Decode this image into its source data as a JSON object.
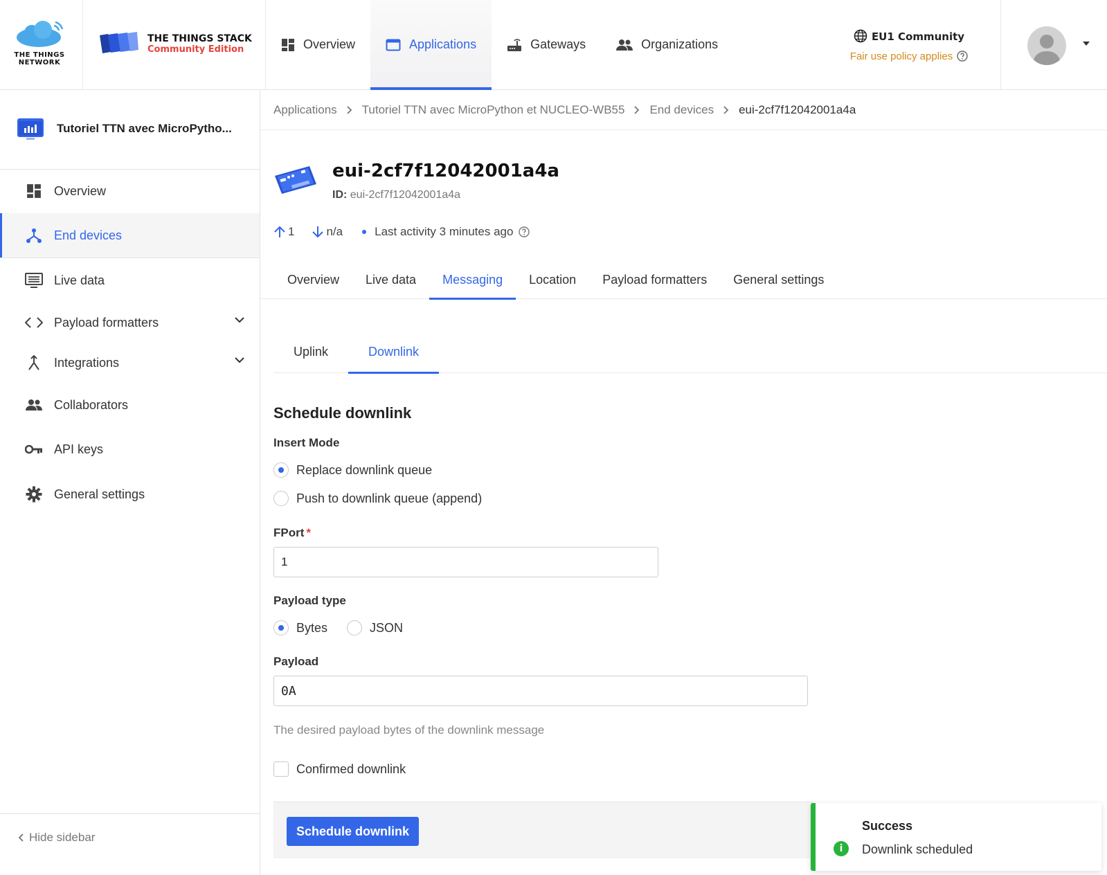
{
  "brand": {
    "ttn_line1": "THE THINGS",
    "ttn_line2": "NETWORK",
    "stack_title": "THE THINGS STACK",
    "stack_edition": "Community Edition"
  },
  "topnav": {
    "items": [
      {
        "label": "Overview",
        "icon": "dashboard-icon",
        "active": false
      },
      {
        "label": "Applications",
        "icon": "application-window-icon",
        "active": true
      },
      {
        "label": "Gateways",
        "icon": "gateway-router-icon",
        "active": false
      },
      {
        "label": "Organizations",
        "icon": "people-icon",
        "active": false
      }
    ],
    "cluster_name": "EU1 Community",
    "cluster_note": "Fair use policy applies"
  },
  "sidebar": {
    "app_title": "Tutoriel TTN avec MicroPytho...",
    "items": [
      {
        "label": "Overview",
        "icon": "dashboard-icon"
      },
      {
        "label": "End devices",
        "icon": "device-hub-icon",
        "active": true
      },
      {
        "label": "Live data",
        "icon": "list-monitor-icon"
      },
      {
        "label": "Payload formatters",
        "icon": "code-icon",
        "expandable": true
      },
      {
        "label": "Integrations",
        "icon": "merge-icon",
        "expandable": true
      },
      {
        "label": "Collaborators",
        "icon": "people-icon"
      },
      {
        "label": "API keys",
        "icon": "key-icon"
      },
      {
        "label": "General settings",
        "icon": "gear-icon"
      }
    ],
    "hide_label": "Hide sidebar"
  },
  "breadcrumb": [
    "Applications",
    "Tutoriel TTN avec MicroPython et NUCLEO-WB55",
    "End devices",
    "eui-2cf7f12042001a4a"
  ],
  "device": {
    "name": "eui-2cf7f12042001a4a",
    "id_label": "ID:",
    "id_value": "eui-2cf7f12042001a4a",
    "uplink_count": "1",
    "downlink_count": "n/a",
    "last_activity": "Last activity 3 minutes ago"
  },
  "tabs": [
    "Overview",
    "Live data",
    "Messaging",
    "Location",
    "Payload formatters",
    "General settings"
  ],
  "active_tab": "Messaging",
  "subtabs": [
    "Uplink",
    "Downlink"
  ],
  "active_subtab": "Downlink",
  "form": {
    "title": "Schedule downlink",
    "insert_mode_label": "Insert Mode",
    "insert_options": [
      "Replace downlink queue",
      "Push to downlink queue (append)"
    ],
    "insert_selected": 0,
    "fport_label": "FPort",
    "fport_required": "*",
    "fport_value": "1",
    "payload_type_label": "Payload type",
    "payload_types": [
      "Bytes",
      "JSON"
    ],
    "payload_type_selected": 0,
    "payload_label": "Payload",
    "payload_value": "0A",
    "payload_hint": "The desired payload bytes of the downlink message",
    "confirmed_label": "Confirmed downlink",
    "confirmed_checked": false,
    "submit_label": "Schedule downlink"
  },
  "toast": {
    "title": "Success",
    "message": "Downlink scheduled",
    "color": "#28b33a"
  },
  "colors": {
    "accent": "#3367e8",
    "warning_text": "#d28a1c",
    "required": "#e5443b"
  }
}
